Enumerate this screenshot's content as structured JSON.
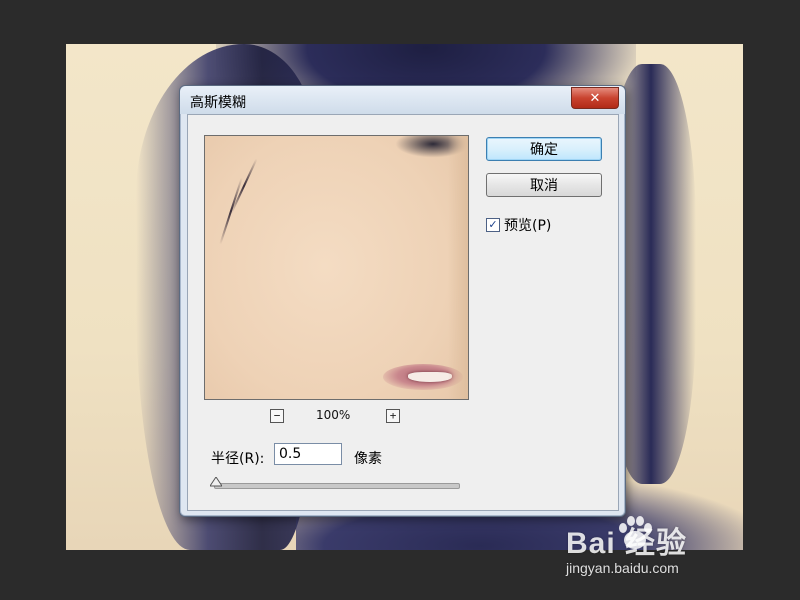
{
  "dialog": {
    "title": "高斯模糊",
    "close_label": "✕"
  },
  "buttons": {
    "ok_label": "确定",
    "cancel_label": "取消"
  },
  "preview_option": {
    "label": "预览(P)",
    "checked": true,
    "check_glyph": "✓"
  },
  "zoom": {
    "minus_label": "−",
    "plus_label": "+",
    "value": "100%"
  },
  "radius": {
    "label": "半径(R):",
    "value": "0.5",
    "unit": "像素"
  },
  "watermark": {
    "logo_text": "Bai  经验",
    "url": "jingyan.baidu.com"
  },
  "colors": {
    "workspace_bg": "#2b2b2b",
    "dialog_bg": "#dfe7f1",
    "close_red": "#c9432f",
    "ok_border": "#3c7fb1"
  },
  "icons": {
    "close": "close-icon",
    "zoom_out": "zoom-out-icon",
    "zoom_in": "zoom-in-icon",
    "checkbox": "checkmark-icon",
    "slider": "slider-thumb-icon",
    "paw": "baidu-paw-icon"
  }
}
